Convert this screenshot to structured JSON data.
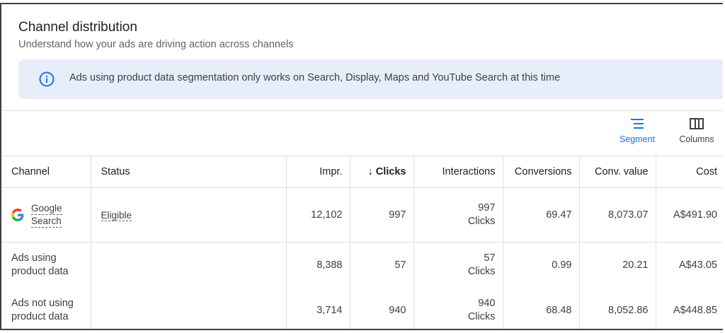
{
  "header": {
    "title": "Channel distribution",
    "subtitle": "Understand how your ads are driving action across channels"
  },
  "banner": {
    "text": "Ads using product data segmentation only works on Search, Display, Maps and YouTube Search at this time",
    "icon": "info-icon",
    "background": "#e8eef9",
    "icon_color": "#1a73e8"
  },
  "toolbar": {
    "segment_label": "Segment",
    "columns_label": "Columns"
  },
  "table": {
    "headers": {
      "channel": "Channel",
      "status": "Status",
      "impr": "Impr.",
      "clicks": "Clicks",
      "clicks_sort": "↓",
      "interactions": "Interactions",
      "conversions": "Conversions",
      "conv_value": "Conv. value",
      "cost": "Cost"
    },
    "rows": [
      {
        "channel_line1": "Google",
        "channel_line2": "Search",
        "status": "Eligible",
        "impr": "12,102",
        "clicks": "997",
        "interactions_value": "997",
        "interactions_unit": "Clicks",
        "conversions": "69.47",
        "conv_value": "8,073.07",
        "cost": "A$491.90"
      },
      {
        "channel_line1": "Ads using",
        "channel_line2": "product data",
        "status": "",
        "impr": "8,388",
        "clicks": "57",
        "interactions_value": "57",
        "interactions_unit": "Clicks",
        "conversions": "0.99",
        "conv_value": "20.21",
        "cost": "A$43.05"
      },
      {
        "channel_line1": "Ads not using",
        "channel_line2": "product data",
        "status": "",
        "impr": "3,714",
        "clicks": "940",
        "interactions_value": "940",
        "interactions_unit": "Clicks",
        "conversions": "68.48",
        "conv_value": "8,052.86",
        "cost": "A$448.85"
      }
    ]
  },
  "colors": {
    "accent": "#1a73e8",
    "text": "#202124",
    "muted": "#5f6368"
  }
}
